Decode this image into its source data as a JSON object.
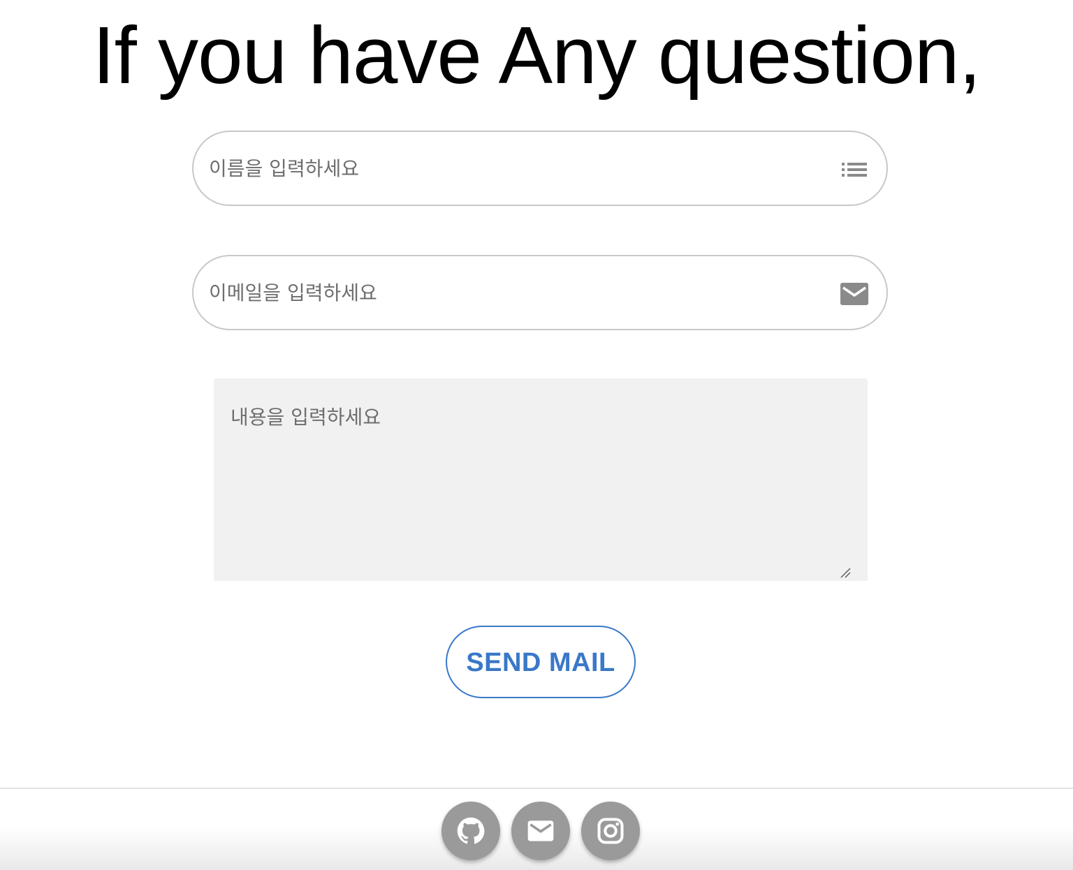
{
  "headline": "If you have Any question,",
  "form": {
    "name_placeholder": "이름을 입력하세요",
    "name_icon": "list-icon",
    "email_placeholder": "이메일을 입력하세요",
    "email_icon": "mail-icon",
    "message_placeholder": "내용을 입력하세요",
    "submit_label": "SEND MAIL"
  },
  "footer": {
    "links": [
      {
        "icon": "github-icon"
      },
      {
        "icon": "mail-icon"
      },
      {
        "icon": "instagram-icon"
      }
    ]
  },
  "colors": {
    "accent": "#3a78c9",
    "icon_gray": "#8a8a8a",
    "social_bg": "#9a9a9a",
    "textarea_bg": "#f1f1f1"
  }
}
